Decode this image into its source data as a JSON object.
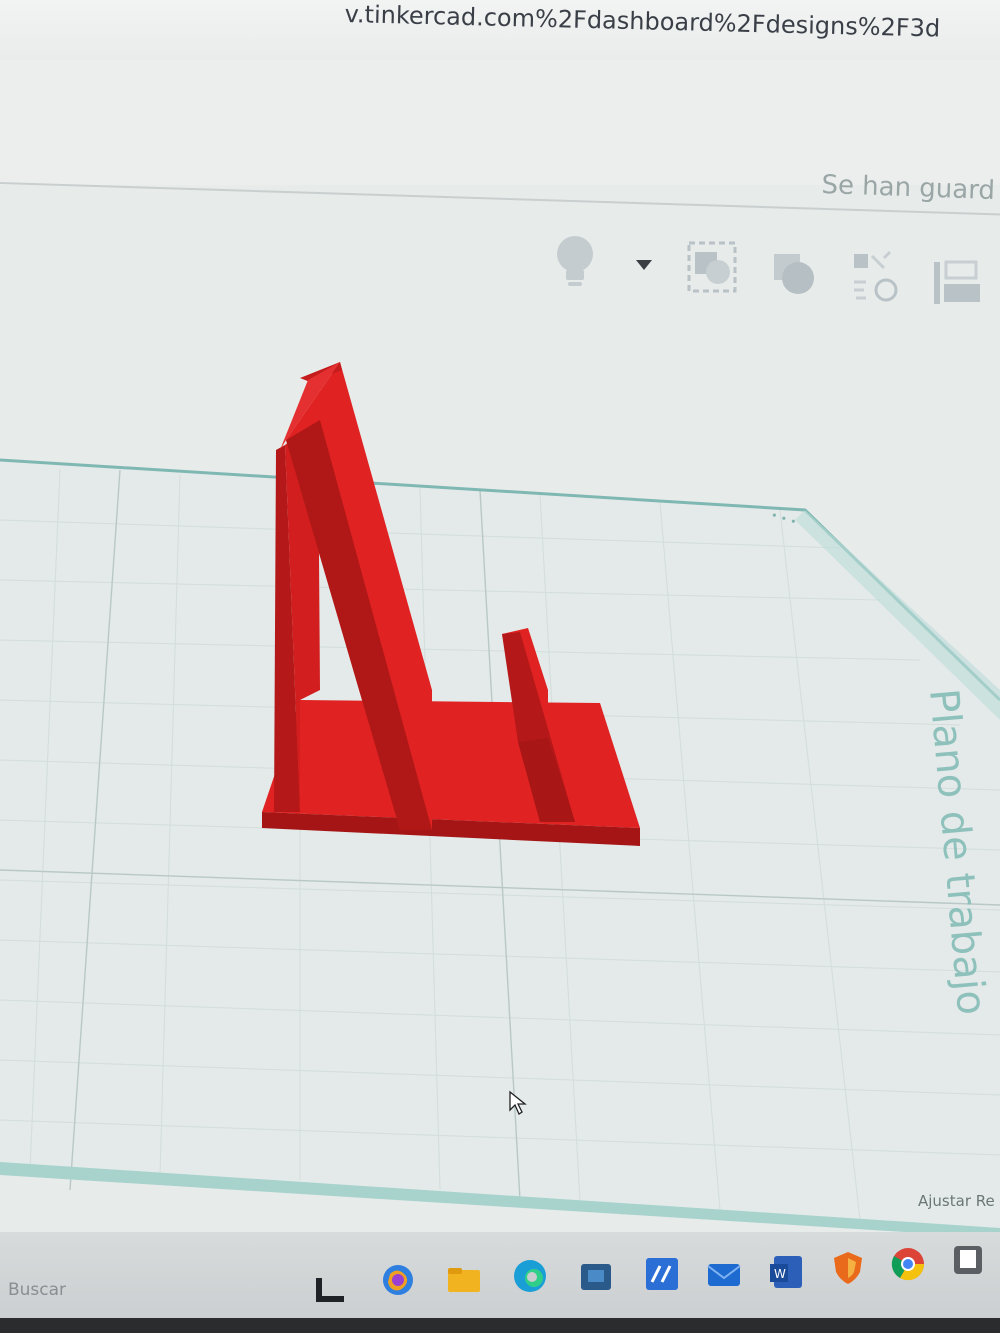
{
  "browser": {
    "url": "v.tinkercad.com%2Fdashboard%2Fdesigns%2F3d"
  },
  "app": {
    "save_status": "Se han guard",
    "toolbar_icons": [
      "lightbulb-icon",
      "dropdown-arrow-icon",
      "group-icon",
      "shapes-icon",
      "align-icon",
      "workplane-icon"
    ]
  },
  "workplane": {
    "edge_label": "Plano de trabajo",
    "snap_label": "Ajustar Re"
  },
  "model": {
    "color": "#e02222",
    "dark_color": "#b01818"
  },
  "taskbar": {
    "search_placeholder": "Buscar",
    "icons": [
      "task-view-icon",
      "copilot-icon",
      "file-explorer-icon",
      "edge-icon",
      "store-icon",
      "app-icon",
      "mail-icon",
      "word-icon",
      "shield-icon",
      "chrome-icon",
      "app2-icon"
    ]
  }
}
